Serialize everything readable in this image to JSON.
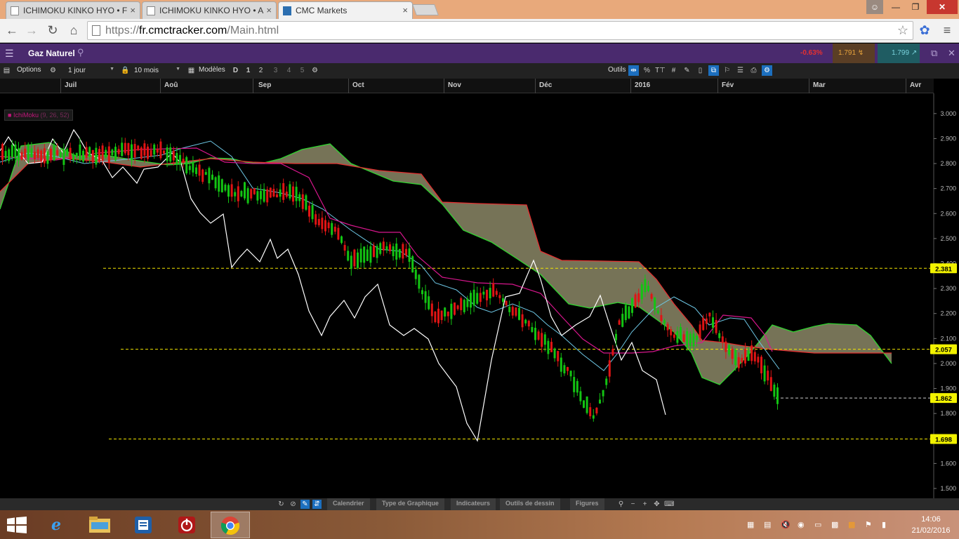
{
  "browser": {
    "tabs": [
      {
        "label": "ICHIMOKU KINKO HYO • F",
        "active": false
      },
      {
        "label": "ICHIMOKU KINKO HYO • A",
        "active": false
      },
      {
        "label": "CMC Markets",
        "active": true
      }
    ],
    "url_scheme": "https://",
    "url_domain": "fr.cmctracker.com",
    "url_path": "/Main.html"
  },
  "app": {
    "instrument": "Gaz Naturel",
    "change_pct": "-0.63%",
    "sell_price": "1.791",
    "buy_price": "1.799"
  },
  "toolbar": {
    "options_label": "Options",
    "interval": "1 jour",
    "range": "10 mois",
    "templates_label": "Modèles",
    "d_label": "D",
    "layout_1": "1",
    "layout_2": "2",
    "layout_3": "3",
    "layout_4": "4",
    "layout_5": "5",
    "tools_label": "Outils"
  },
  "months": [
    "Juil",
    "Aoû",
    "Sep",
    "Oct",
    "Nov",
    "Déc",
    "2016",
    "Fév",
    "Mar",
    "Avr"
  ],
  "chart_data": {
    "type": "candlestick",
    "indicator": "IchiMoku",
    "indicator_params": "(9, 26, 52)",
    "y_ticks": [
      "3.000",
      "2.900",
      "2.800",
      "2.700",
      "2.600",
      "2.500",
      "2.400",
      "2.300",
      "2.200",
      "2.100",
      "2.000",
      "1.900",
      "1.800",
      "1.700",
      "1.600",
      "1.500"
    ],
    "ylim": [
      1.45,
      3.05
    ],
    "price_tags": [
      "2.381",
      "2.057",
      "1.862",
      "1.698"
    ],
    "grid": false,
    "colors": {
      "up": "#13c413",
      "down": "#e01414",
      "tenkan": "#6ec8e6",
      "kijun": "#d6168c",
      "chikou": "#ffffff",
      "senkou_a": "#2fd42f",
      "senkou_b": "#e33030",
      "cloud": "#8b8766",
      "level_line": "#f2e600"
    }
  },
  "bottom_bar": {
    "tabs": [
      "Calendrier",
      "Type de Graphique",
      "Indicateurs",
      "Outils de dessin",
      "Figures"
    ]
  },
  "taskbar": {
    "time": "14:06",
    "date": "21/02/2016"
  }
}
